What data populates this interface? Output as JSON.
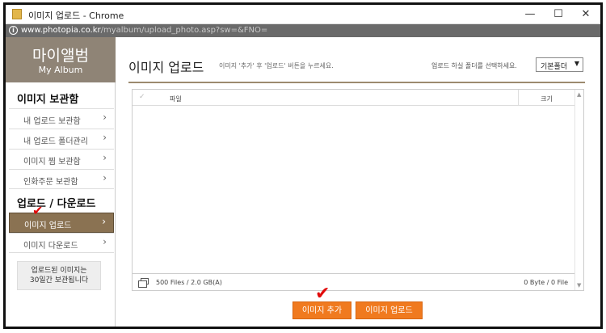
{
  "window": {
    "title": "이미지 업로드 - Chrome",
    "minimize": "—",
    "maximize": "☐",
    "close": "✕"
  },
  "address": {
    "host": "www.photopia.co.kr",
    "path": "/myalbum/upload_photo.asp?sw=&FNO="
  },
  "sidebar": {
    "logo_ko": "마이앨범",
    "logo_en": "My Album",
    "section1": "이미지 보관함",
    "items1": [
      {
        "label": "내 업로드 보관함"
      },
      {
        "label": "내 업로드 폴더관리"
      },
      {
        "label": "이미지 찜 보관함"
      },
      {
        "label": "인화주문 보관함"
      }
    ],
    "section2": "업로드 / 다운로드",
    "items2": [
      {
        "label": "이미지 업로드"
      },
      {
        "label": "이미지 다운로드"
      }
    ],
    "notice": "업로드된 이미지는\n30일간 보관됩니다",
    "chevron": "›"
  },
  "main": {
    "title": "이미지 업로드",
    "hint": "이미지 '추가' 후 '업로드' 버튼을 누르세요.",
    "folder_label": "업로드 하실 폴더를 선택하세요.",
    "folder_value": "기본폴더",
    "table": {
      "col_file": "파일",
      "col_size": "크기",
      "file_count": "500 Files / 2.0 GB(A)",
      "size_total": "0 Byte / 0 File"
    },
    "add_button": "이미지 추가",
    "upload_button": "이미지 업로드"
  },
  "colors": {
    "accent": "#f07a1f",
    "logo_bg": "#8f8476",
    "active_bg": "#8a7252",
    "check": "#e10b0b"
  }
}
